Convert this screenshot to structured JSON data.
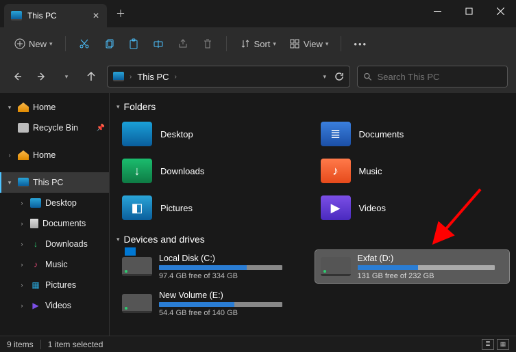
{
  "window": {
    "tab_title": "This PC"
  },
  "toolbar": {
    "new_label": "New",
    "sort_label": "Sort",
    "view_label": "View"
  },
  "breadcrumb": {
    "location": "This PC"
  },
  "search": {
    "placeholder": "Search This PC"
  },
  "sidebar": {
    "home": "Home",
    "recycle_bin": "Recycle Bin",
    "home2": "Home",
    "this_pc": "This PC",
    "desktop": "Desktop",
    "documents": "Documents",
    "downloads": "Downloads",
    "music": "Music",
    "pictures": "Pictures",
    "videos": "Videos"
  },
  "groups": {
    "folders": "Folders",
    "drives": "Devices and drives"
  },
  "folders": [
    {
      "name": "Desktop"
    },
    {
      "name": "Documents"
    },
    {
      "name": "Downloads"
    },
    {
      "name": "Music"
    },
    {
      "name": "Pictures"
    },
    {
      "name": "Videos"
    }
  ],
  "drives": [
    {
      "name": "Local Disk (C:)",
      "free_text": "97.4 GB free of 334 GB",
      "fill_pct": 71,
      "selected": false,
      "win": true
    },
    {
      "name": "Exfat (D:)",
      "free_text": "131 GB free of 232 GB",
      "fill_pct": 44,
      "selected": true,
      "win": false
    },
    {
      "name": "New Volume (E:)",
      "free_text": "54.4 GB free of 140 GB",
      "fill_pct": 61,
      "selected": false,
      "win": false
    }
  ],
  "status": {
    "items": "9 items",
    "selected": "1 item selected"
  }
}
